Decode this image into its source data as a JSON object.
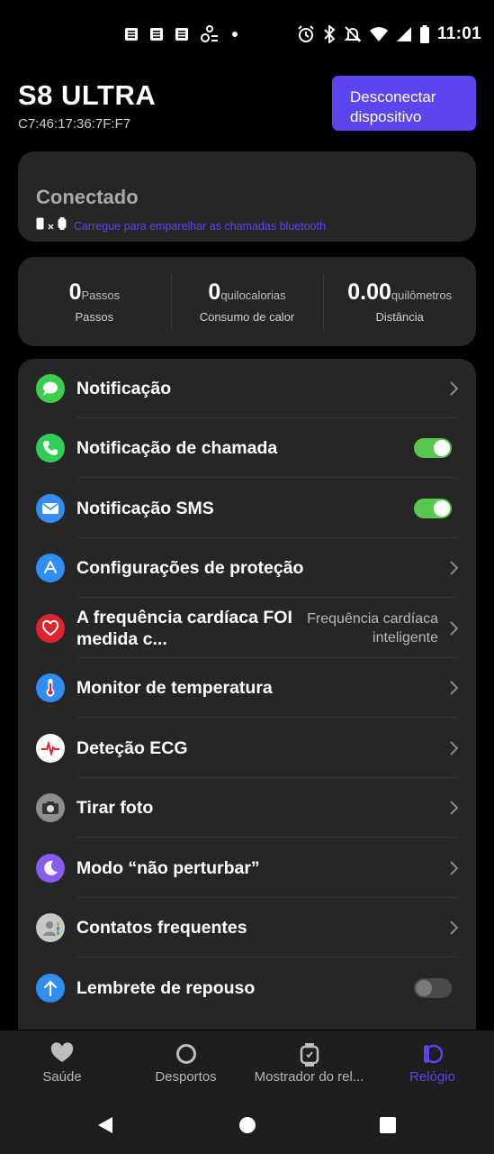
{
  "status_bar": {
    "time": "11:01",
    "left_icons": [
      "news-icon",
      "news-icon",
      "news-icon",
      "accessibility-icon",
      "dot-icon"
    ],
    "right_icons": [
      "alarm-icon",
      "bluetooth-icon",
      "mute-icon",
      "wifi-icon",
      "signal-icon",
      "battery-icon"
    ]
  },
  "header": {
    "device_name": "S8 ULTRA",
    "mac_address": "C7:46:17:36:7F:F7",
    "disconnect_label": "Desconectar dispositivo"
  },
  "connection": {
    "status": "Conectado",
    "hint": "Carregue para emparelhar as chamadas bluetooth"
  },
  "stats": [
    {
      "value": "0",
      "unit": "Passos",
      "label": "Passos"
    },
    {
      "value": "0",
      "unit": "quilocalorias",
      "label": "Consumo de calor"
    },
    {
      "value": "0.00",
      "unit": "quilômetros",
      "label": "Distância"
    }
  ],
  "settings": [
    {
      "label": "Notificação",
      "icon": "message-icon",
      "icon_color": "#3ccf4e",
      "control": "chevron"
    },
    {
      "label": "Notificação de chamada",
      "icon": "phone-icon",
      "icon_color": "#2fcf55",
      "control": "toggle",
      "toggle_on": true
    },
    {
      "label": "Notificação SMS",
      "icon": "mail-icon",
      "icon_color": "#2f8ef0",
      "control": "toggle",
      "toggle_on": true
    },
    {
      "label": "Configurações de proteção",
      "icon": "app-store-icon",
      "icon_color": "#2f8ef0",
      "control": "chevron"
    },
    {
      "label": "A frequência cardíaca FOI medida c...",
      "icon": "heart-icon",
      "icon_color": "#e0222e",
      "control": "chevron",
      "value": "Frequência cardíaca inteligente"
    },
    {
      "label": "Monitor de temperatura",
      "icon": "thermometer-icon",
      "icon_color": "#2f8ef0",
      "control": "chevron"
    },
    {
      "label": "Deteção ECG",
      "icon": "ecg-icon",
      "icon_color": "#ffffff",
      "control": "chevron"
    },
    {
      "label": "Tirar foto",
      "icon": "camera-icon",
      "icon_color": "#8e8e8e",
      "control": "chevron"
    },
    {
      "label": "Modo “não perturbar”",
      "icon": "moon-icon",
      "icon_color": "#8a5cf0",
      "control": "chevron"
    },
    {
      "label": "Contatos frequentes",
      "icon": "contacts-icon",
      "icon_color": "#c8c8c8",
      "control": "chevron"
    },
    {
      "label": "Lembrete de repouso",
      "icon": "arrow-up-icon",
      "icon_color": "#2f8ef0",
      "control": "toggle",
      "toggle_on": false
    }
  ],
  "tabs": [
    {
      "label": "Saúde",
      "icon": "heart-tab-icon",
      "active": false
    },
    {
      "label": "Desportos",
      "icon": "circle-tab-icon",
      "active": false
    },
    {
      "label": "Mostrador do rel...",
      "icon": "watch-tab-icon",
      "active": false
    },
    {
      "label": "Relógio",
      "icon": "watch-side-tab-icon",
      "active": true
    }
  ],
  "colors": {
    "accent": "#5b45ee",
    "toggle_on": "#57c84d",
    "card_bg": "#262626",
    "background": "#000000"
  }
}
